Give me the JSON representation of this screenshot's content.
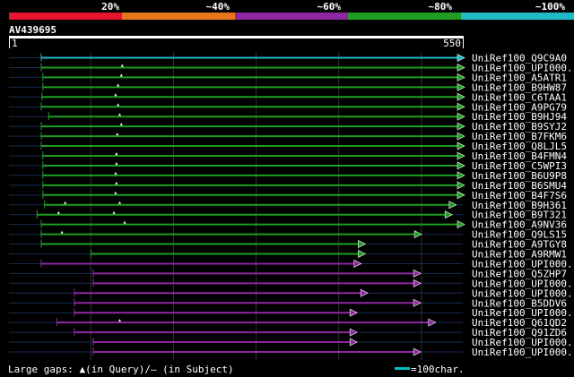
{
  "colors": {
    "background": "#000000",
    "text": "#ffffff",
    "ruler": "#ffffff",
    "grid": "#333333",
    "track": "#1a2a55",
    "legend_line": "#00bfc8"
  },
  "scale_bar": {
    "segments": [
      {
        "color": "#e8132e",
        "label": "20%"
      },
      {
        "color": "#e6761b",
        "label": "~40%"
      },
      {
        "color": "#8e27a1",
        "label": "~60%"
      },
      {
        "color": "#1f9e23",
        "label": "~80%"
      },
      {
        "color": "#20bac6",
        "label": "~100%"
      }
    ]
  },
  "query": {
    "name": "AV439695",
    "start": "1",
    "end": "550"
  },
  "footer": {
    "gaps_text": "Large gaps: ▲(in Query)/— (in Subject)",
    "legend_text": "=100char."
  },
  "chart_data": {
    "type": "alignment",
    "query_length": 550,
    "hits": [
      {
        "name": "UniRef100_Q9C9A0",
        "identity_class": "~100%",
        "start": 40,
        "end": 550,
        "gaps": []
      },
      {
        "name": "UniRef100_UPI000...",
        "identity_class": "~80%",
        "start": 40,
        "end": 550,
        "gaps": [
          138
        ]
      },
      {
        "name": "UniRef100_A5ATR1",
        "identity_class": "~80%",
        "start": 42,
        "end": 550,
        "gaps": [
          137
        ]
      },
      {
        "name": "UniRef100_B9HW87",
        "identity_class": "~80%",
        "start": 42,
        "end": 550,
        "gaps": [
          133
        ]
      },
      {
        "name": "UniRef100_C6TAA1",
        "identity_class": "~80%",
        "start": 41,
        "end": 550,
        "gaps": [
          130
        ]
      },
      {
        "name": "UniRef100_A9PG79",
        "identity_class": "~80%",
        "start": 40,
        "end": 550,
        "gaps": [
          133
        ]
      },
      {
        "name": "UniRef100_B9HJ94",
        "identity_class": "~80%",
        "start": 49,
        "end": 550,
        "gaps": [
          135
        ]
      },
      {
        "name": "UniRef100_B9SYJ2",
        "identity_class": "~80%",
        "start": 40,
        "end": 550,
        "gaps": [
          137
        ]
      },
      {
        "name": "UniRef100_B7FKM6",
        "identity_class": "~80%",
        "start": 40,
        "end": 550,
        "gaps": [
          132
        ]
      },
      {
        "name": "UniRef100_Q8LJL5",
        "identity_class": "~80%",
        "start": 40,
        "end": 550,
        "gaps": []
      },
      {
        "name": "UniRef100_B4FMN4",
        "identity_class": "~80%",
        "start": 42,
        "end": 550,
        "gaps": [
          131
        ]
      },
      {
        "name": "UniRef100_C5WPI3",
        "identity_class": "~80%",
        "start": 42,
        "end": 550,
        "gaps": [
          131
        ]
      },
      {
        "name": "UniRef100_B6U9P8",
        "identity_class": "~80%",
        "start": 42,
        "end": 550,
        "gaps": [
          130
        ]
      },
      {
        "name": "UniRef100_B6SMU4",
        "identity_class": "~80%",
        "start": 42,
        "end": 550,
        "gaps": [
          131
        ]
      },
      {
        "name": "UniRef100_B4F7S6",
        "identity_class": "~80%",
        "start": 42,
        "end": 550,
        "gaps": [
          130
        ]
      },
      {
        "name": "UniRef100_B9H361",
        "identity_class": "~80%",
        "start": 44,
        "end": 540,
        "gaps": [
          69,
          135
        ]
      },
      {
        "name": "UniRef100_B9T321",
        "identity_class": "~80%",
        "start": 35,
        "end": 535,
        "gaps": [
          61,
          128
        ]
      },
      {
        "name": "UniRef100_A9NV36",
        "identity_class": "~80%",
        "start": 40,
        "end": 550,
        "gaps": [
          141
        ]
      },
      {
        "name": "UniRef100_Q9LS15",
        "identity_class": "~80%",
        "start": 40,
        "end": 498,
        "gaps": [
          65
        ]
      },
      {
        "name": "UniRef100_A9TGY8",
        "identity_class": "~80%",
        "start": 40,
        "end": 430,
        "gaps": []
      },
      {
        "name": "UniRef100_A9RMW1",
        "identity_class": "~80%",
        "start": 100,
        "end": 430,
        "gaps": []
      },
      {
        "name": "UniRef100_UPI000...",
        "identity_class": "~60%",
        "start": 40,
        "end": 425,
        "gaps": []
      },
      {
        "name": "UniRef100_Q5ZHP7",
        "identity_class": "~60%",
        "start": 103,
        "end": 497,
        "gaps": []
      },
      {
        "name": "UniRef100_UPI000...",
        "identity_class": "~60%",
        "start": 103,
        "end": 497,
        "gaps": []
      },
      {
        "name": "UniRef100_UPI000...",
        "identity_class": "~60%",
        "start": 80,
        "end": 433,
        "gaps": []
      },
      {
        "name": "UniRef100_B5DDV6",
        "identity_class": "~60%",
        "start": 80,
        "end": 497,
        "gaps": []
      },
      {
        "name": "UniRef100_UPI000...",
        "identity_class": "~60%",
        "start": 80,
        "end": 420,
        "gaps": []
      },
      {
        "name": "UniRef100_Q61QD2",
        "identity_class": "~60%",
        "start": 59,
        "end": 515,
        "gaps": [
          135
        ]
      },
      {
        "name": "UniRef100_Q91ZD6",
        "identity_class": "~60%",
        "start": 80,
        "end": 420,
        "gaps": []
      },
      {
        "name": "UniRef100_UPI000...",
        "identity_class": "~60%",
        "start": 103,
        "end": 420,
        "gaps": []
      },
      {
        "name": "UniRef100_UPI000...",
        "identity_class": "~60%",
        "start": 103,
        "end": 497,
        "gaps": []
      }
    ]
  }
}
